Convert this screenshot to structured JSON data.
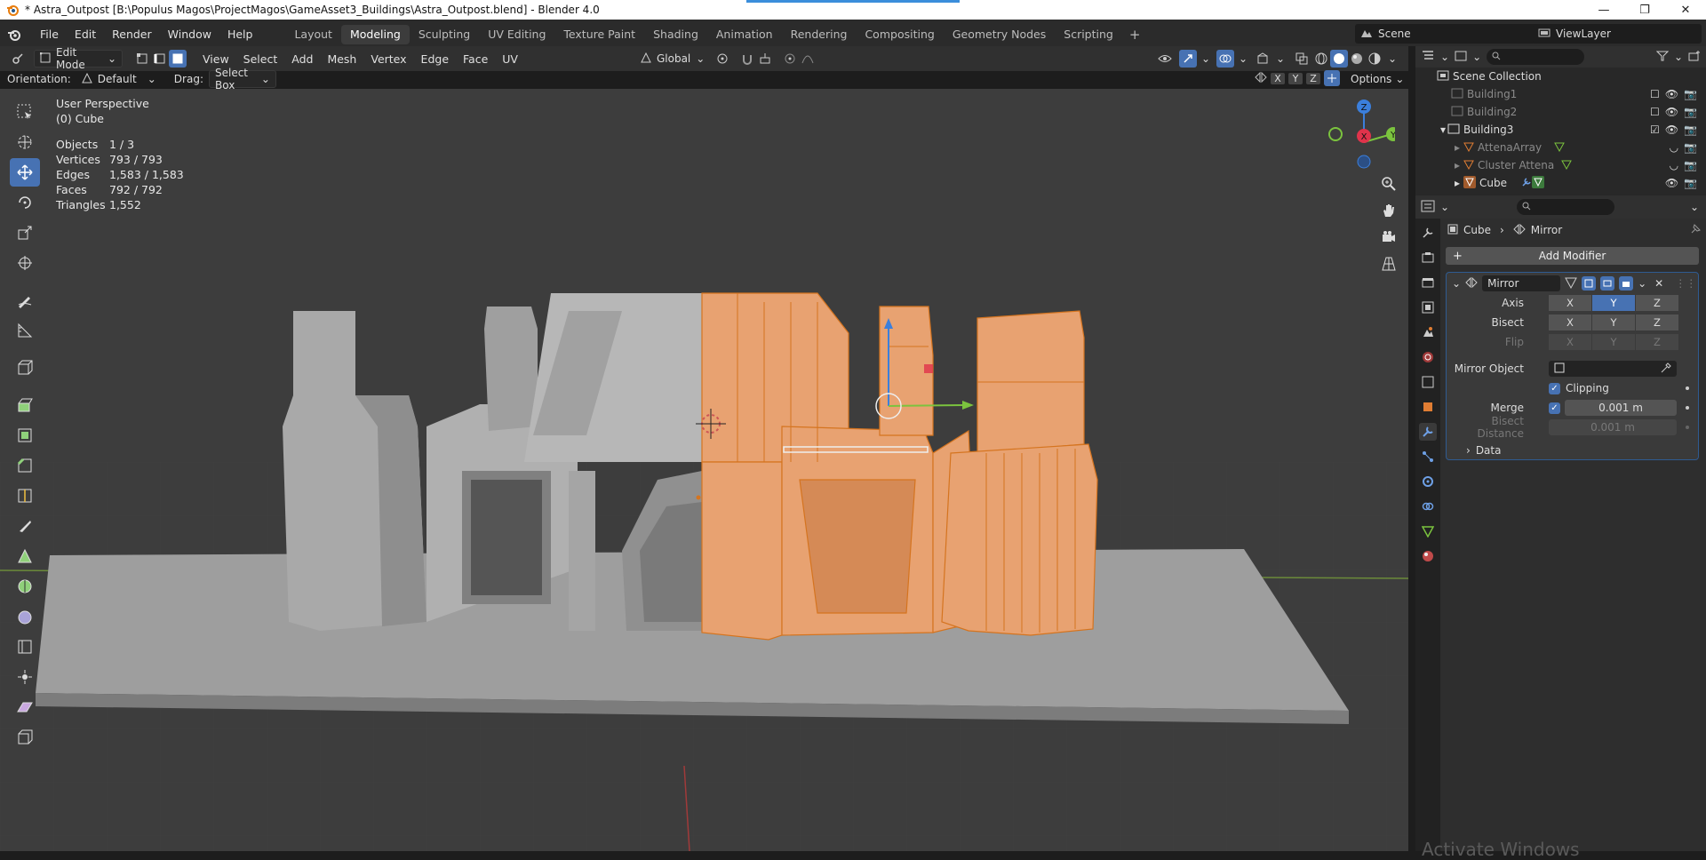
{
  "window": {
    "title": "* Astra_Outpost [B:\\Populus Magos\\ProjectMagos\\GameAsset3_Buildings\\Astra_Outpost.blend] - Blender 4.0",
    "controls": [
      "—",
      "❐",
      "✕"
    ]
  },
  "menu": [
    "File",
    "Edit",
    "Render",
    "Window",
    "Help"
  ],
  "workspaces": [
    "Layout",
    "Modeling",
    "Sculpting",
    "UV Editing",
    "Texture Paint",
    "Shading",
    "Animation",
    "Rendering",
    "Compositing",
    "Geometry Nodes",
    "Scripting"
  ],
  "active_workspace": "Modeling",
  "scene": "Scene",
  "view_layer": "ViewLayer",
  "viewport_header": {
    "mode": "Edit Mode",
    "menus": [
      "View",
      "Select",
      "Add",
      "Mesh",
      "Vertex",
      "Edge",
      "Face",
      "UV"
    ],
    "transform": "Global",
    "orientation_label": "Orientation:",
    "orientation": "Default",
    "drag_label": "Drag:",
    "drag": "Select Box",
    "axis_buttons": [
      "X",
      "Y",
      "Z"
    ],
    "options": "Options"
  },
  "overlay": {
    "view": "User Perspective",
    "object": "(0) Cube",
    "stats": [
      {
        "label": "Objects",
        "value": "1 / 3"
      },
      {
        "label": "Vertices",
        "value": "793 / 793"
      },
      {
        "label": "Edges",
        "value": "1,583 / 1,583"
      },
      {
        "label": "Faces",
        "value": "792 / 792"
      },
      {
        "label": "Triangles",
        "value": "1,552"
      }
    ]
  },
  "gizmo": {
    "x": "X",
    "y": "Y",
    "z": "Z"
  },
  "outliner": {
    "root": "Scene Collection",
    "items": [
      {
        "name": "Building1",
        "dim": true
      },
      {
        "name": "Building2",
        "dim": true
      },
      {
        "name": "Building3",
        "dim": false
      },
      {
        "name": "AttenaArray",
        "dim": true
      },
      {
        "name": "Cluster Attena",
        "dim": true
      },
      {
        "name": "Cube",
        "dim": false
      }
    ]
  },
  "properties": {
    "breadcrumb_object": "Cube",
    "breadcrumb_modifier": "Mirror",
    "add_modifier": "Add Modifier",
    "modifier": {
      "name": "Mirror",
      "axis_label": "Axis",
      "bisect_label": "Bisect",
      "flip_label": "Flip",
      "xyz": [
        "X",
        "Y",
        "Z"
      ],
      "mirror_object_label": "Mirror Object",
      "clipping_label": "Clipping",
      "merge_label": "Merge",
      "merge_value": "0.001 m",
      "bisect_distance_label": "Bisect Distance",
      "bisect_distance_value": "0.001 m",
      "data_label": "Data"
    }
  },
  "watermark": "Activate Windows",
  "colors": {
    "accent": "#4772b3",
    "selection": "#e89a4c",
    "x_axis": "#e0334b",
    "y_axis": "#7bc33e",
    "z_axis": "#3b7fdc"
  }
}
